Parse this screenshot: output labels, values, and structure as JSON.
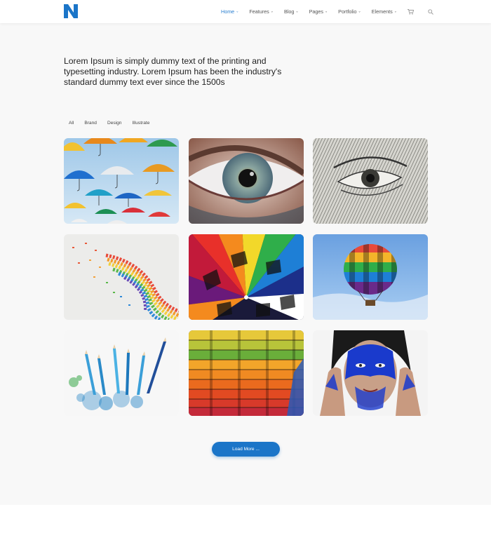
{
  "header": {
    "logo_icon": "n-logo-icon",
    "brand_color": "#1b75c8",
    "nav": [
      {
        "label": "Home",
        "active": true,
        "has_dropdown": true
      },
      {
        "label": "Features",
        "active": false,
        "has_dropdown": true
      },
      {
        "label": "Blog",
        "active": false,
        "has_dropdown": true
      },
      {
        "label": "Pages",
        "active": false,
        "has_dropdown": true
      },
      {
        "label": "Portfolio",
        "active": false,
        "has_dropdown": true
      },
      {
        "label": "Elements",
        "active": false,
        "has_dropdown": true
      }
    ],
    "cart_icon": "cart-icon",
    "search_icon": "search-icon"
  },
  "intro": {
    "text": "Lorem Ipsum is simply dummy text of the printing and typesetting industry. Lorem Ipsum has been the industry's standard dummy text ever since the 1500s"
  },
  "filters": [
    "All",
    "Brand",
    "Design",
    "Illustrate"
  ],
  "gallery": {
    "items": [
      {
        "subject": "colorful-umbrellas"
      },
      {
        "subject": "eye-closeup"
      },
      {
        "subject": "banknote-eye-engraving"
      },
      {
        "subject": "rainbow-paper-pieces"
      },
      {
        "subject": "hot-air-balloon-interior"
      },
      {
        "subject": "hot-air-balloon-sky"
      },
      {
        "subject": "blue-pencils-shavings"
      },
      {
        "subject": "rainbow-stacked-paper"
      },
      {
        "subject": "blue-painted-face"
      }
    ]
  },
  "load_more": {
    "label": "Load More ..."
  },
  "colors": {
    "accent": "#1b75c8",
    "active_nav": "#2a7fd0",
    "page_bg": "#f8f8f8"
  }
}
